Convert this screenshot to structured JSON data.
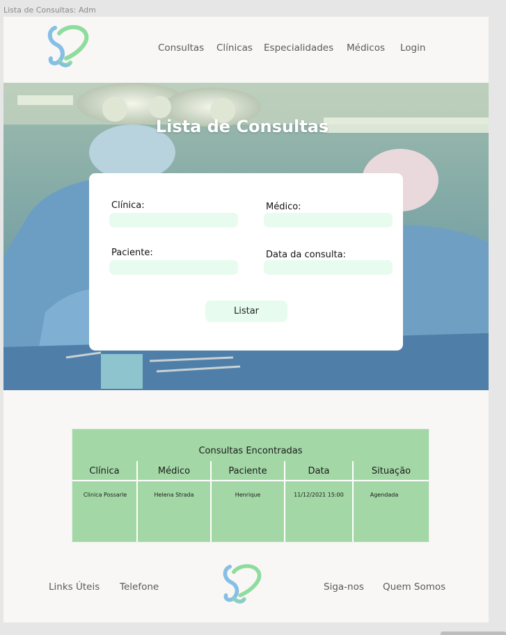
{
  "frame": {
    "label": "Lista de Consultas: Adm"
  },
  "brand": {
    "logo_icon": "heart-stethoscope-icon",
    "color_blue": "#8cc3e6",
    "color_green": "#8fdc9f"
  },
  "nav": {
    "items": [
      "Consultas",
      "Clínicas",
      "Especialidades",
      "Médicos",
      "Login"
    ]
  },
  "hero": {
    "title": "Lista de Consultas",
    "background": "operating-room-photo"
  },
  "form": {
    "clinica_label": "Clínica:",
    "clinica_value": "",
    "medico_label": "Médico:",
    "medico_value": "",
    "paciente_label": "Paciente:",
    "paciente_value": "",
    "data_label": "Data da consulta:",
    "data_value": "",
    "submit_label": "Listar",
    "input_color": "#e7fbef"
  },
  "results": {
    "title": "Consultas Encontradas",
    "columns": [
      "Clínica",
      "Médico",
      "Paciente",
      "Data",
      "Situação"
    ],
    "rows": [
      [
        "Clinica Possarle",
        "Helena Strada",
        "Henrique",
        "11/12/2021 15:00",
        "Agendada"
      ]
    ],
    "background": "#a3d8a6"
  },
  "footer": {
    "left_links": [
      "Links Úteis",
      "Telefone"
    ],
    "right_links": [
      "Siga-nos",
      "Quem Somos"
    ]
  }
}
